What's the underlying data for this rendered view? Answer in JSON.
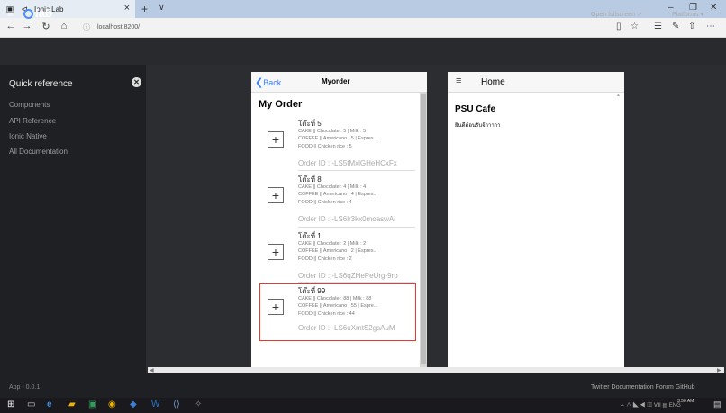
{
  "browser": {
    "tab_title": "Ionic Lab",
    "new_tab": "+",
    "tab_menu": "∨",
    "url": "localhost:8200/"
  },
  "lab": {
    "logo_text": "lab",
    "open_fullscreen": "Open fullscreen ↗",
    "platforms": "Platforms ▾"
  },
  "sidebar": {
    "title": "Quick reference",
    "items": [
      {
        "label": "Components"
      },
      {
        "label": "API Reference"
      },
      {
        "label": "Ionic Native"
      },
      {
        "label": "All Documentation"
      }
    ]
  },
  "footer": {
    "version": "App - 0.0.1",
    "links": "Twitter   Documentation   Forum   GitHub"
  },
  "taskbar": {
    "time": "3:50 AM",
    "tray": "ㅅ ∧ ◣ ◀ ▥ Ⅷ ▤ ENG"
  },
  "phone1": {
    "back_label": "Back",
    "title": "Myorder",
    "heading": "My Order",
    "orders": [
      {
        "table": "โต๊ะที่ 5",
        "cake": "CAKE || Chocolate : 5 | Milk : 5",
        "coffee": "COFFEE || Americano : 5 | Espres...",
        "food": "FOOD || Chicken rice : 5",
        "order_id": "Order ID : -LS5tMxlGHeHCxFx"
      },
      {
        "table": "โต๊ะที่ 8",
        "cake": "CAKE || Chocolate : 4 | Milk : 4",
        "coffee": "COFFEE || Americano : 4 | Espres...",
        "food": "FOOD || Chicken rice : 4",
        "order_id": "Order ID : -LS6lr3kx0moaswAl"
      },
      {
        "table": "โต๊ะที่ 1",
        "cake": "CAKE || Chocolate : 2 | Milk : 2",
        "coffee": "COFFEE || Americano : 2 | Espres...",
        "food": "FOOD || Chicken rice : 2",
        "order_id": "Order ID : -LS6qZHePeUrg-9ro"
      },
      {
        "table": "โต๊ะที่ 99",
        "cake": "CAKE || Chocolate : 88 | Milk : 88",
        "coffee": "COFFEE || Americano : 55 | Espre...",
        "food": "FOOD || Chicken rice : 44",
        "order_id": "Order ID : -LS6uXmtS2gsAuM"
      }
    ]
  },
  "phone2": {
    "title": "Home",
    "heading": "PSU Cafe",
    "welcome": "ยินดีต้อนรับจ้าาาาา"
  },
  "colors": {
    "accent": "#3880ff",
    "selection": "#e8392f"
  }
}
